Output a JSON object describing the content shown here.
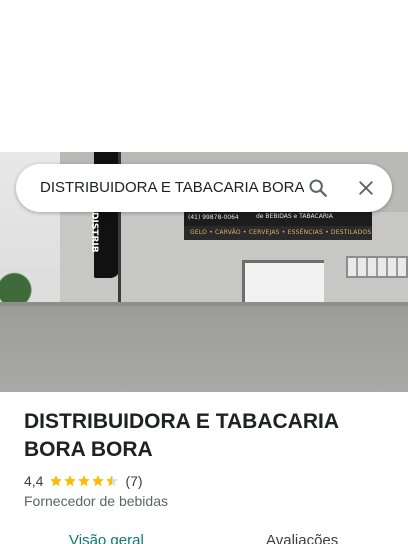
{
  "search": {
    "query": "DISTRIBUIDORA E TABACARIA BORA BORA"
  },
  "photo": {
    "sign_phone": "(41) 99878-0064",
    "sign_brand": "de BEBIDAS e TABACARIA",
    "sign_items": "GELO • CARVÃO • CERVEJAS • ESSÊNCIAS • DESTILADOS",
    "flag_text": "DISTRIB"
  },
  "place": {
    "name": "DISTRIBUIDORA E TABACARIA BORA BORA",
    "rating": "4,4",
    "stars": 4.4,
    "reviews_count": "(7)",
    "category": "Fornecedor de bebidas"
  },
  "tabs": [
    {
      "label": "Visão geral"
    },
    {
      "label": "Avaliações"
    }
  ],
  "colors": {
    "star": "#fbbc04",
    "active_tab": "#0b7a75"
  }
}
